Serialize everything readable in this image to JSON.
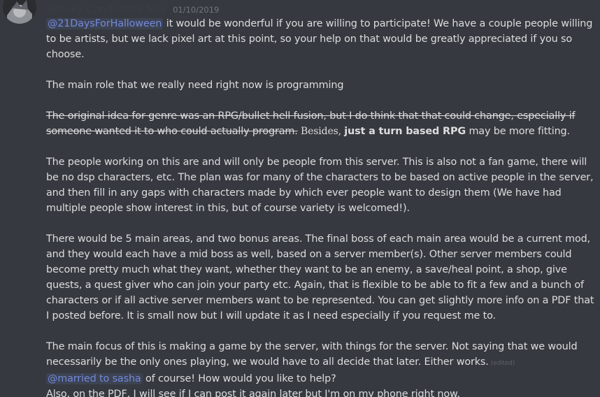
{
  "message": {
    "author": "Spooky Condensed Milk",
    "timestamp": "01/10/2019",
    "avatar_icon": "chibi-character-avatar",
    "p1": {
      "mention": "@21DaysForHalloween",
      "text": " it would be wonderful if you are willing to participate! We have a couple people willing to be artists, but we  lack pixel art at this point, so your help on that would be greatly appreciated if you so choose."
    },
    "p2": "The main role that we really need right now is programming",
    "p3": {
      "strike": "The original idea for genre was an RPG/bullet hell fusion, but I do think that that could change, especially if someone wanted it to who could actually program.",
      "besides": " Besides, ",
      "bold": "just a turn based RPG",
      "rest": " may be more fitting."
    },
    "p4": "The people working on this are and will only be people from this server. This is also not a fan game, there will be no dsp characters, etc. The plan was for many of the characters to be based on active people in the server, and then fill in any gaps with characters made by which ever people want to design them (We have had multiple people show interest in this, but of course variety is welcomed!).",
    "p5": "There would be 5 main areas, and two bonus areas. The final boss of each main area would be a current mod, and they would each have a mid boss as well, based on a server member(s). Other server members could become pretty much what they want, whether they want to be an enemy, a save/heal point, a shop, give quests, a quest giver who can join your party etc. Again, that is flexible to be able to fit a few and a bunch of characters or if all active server members want to be represented. You can get slightly more info on a PDF that I posted before. It is small now but I will update it as I need especially if you request me to.",
    "p6": {
      "text": "The main focus of this is making a game by the server, with things for the server. Not saying that we would necessarily be the only ones playing, we would have to all decide that later. Either works.",
      "edited": "(edited)"
    },
    "p7": {
      "mention": "@married to sasha",
      "text": " of course! How would you like to help?"
    },
    "p8": "Also, on the PDF, I will see if I can post it again later but I'm on my phone right now."
  }
}
